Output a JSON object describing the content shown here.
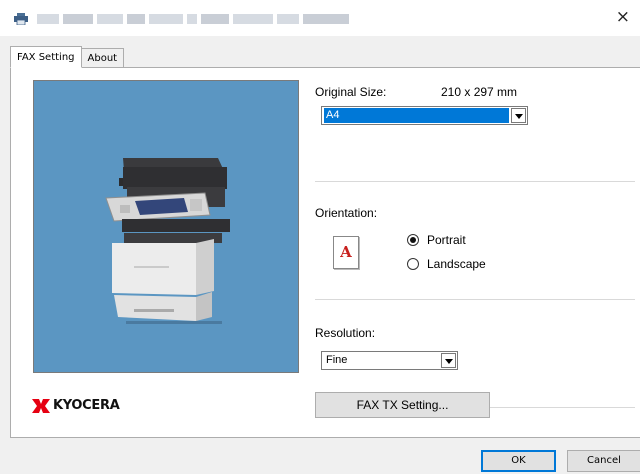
{
  "window": {
    "close_glyph": "×",
    "app_icon": "printer-icon",
    "title_hidden": true
  },
  "tabs": [
    {
      "label": "FAX Setting",
      "active": true
    },
    {
      "label": "About",
      "active": false
    }
  ],
  "original_size": {
    "label": "Original Size:",
    "dimensions": "210 x 297 mm",
    "selected": "A4"
  },
  "orientation": {
    "label": "Orientation:",
    "icon_letter": "A",
    "options": [
      {
        "label": "Portrait",
        "checked": true
      },
      {
        "label": "Landscape",
        "checked": false
      }
    ]
  },
  "resolution": {
    "label": "Resolution:",
    "selected": "Fine"
  },
  "fax_tx_button": "FAX TX Setting...",
  "brand": {
    "name": "KYOCERA",
    "color": "#e60012"
  },
  "footer": {
    "ok": "OK",
    "cancel": "Cancel"
  },
  "colors": {
    "preview_bg": "#5b96c2",
    "selection": "#0078d7"
  }
}
